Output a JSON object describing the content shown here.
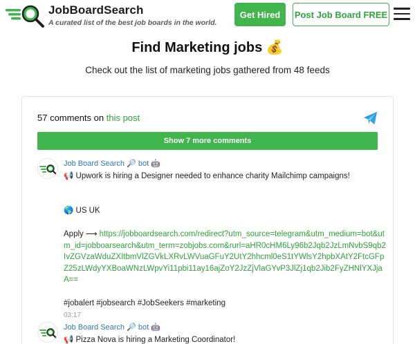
{
  "header": {
    "brand": "JobBoardSearch",
    "tagline": "A curated list of the best job boards in the world.",
    "get_hired_label": "Get Hired",
    "post_job_label": "Post Job Board FREE"
  },
  "hero": {
    "title": "Find Marketing jobs 💰",
    "subtitle": "Check out the list of marketing jobs gathered from 48 feeds"
  },
  "comments": {
    "count_text": "57 comments on",
    "post_link": "this post",
    "show_more_label": "Show 7 more comments",
    "items": [
      {
        "author": "Job Board Search 🔎 bot 🤖",
        "headline": "📢 Upwork is hiring a Designer needed to enhance charity Mailchimp campaigns!",
        "location": "🌎 US UK",
        "apply_prefix": "Apply ⟶ ",
        "apply_url": "https://jobboardsearch.com/redirect?utm_source=telegram&utm_medium=bot&utm_id=jobboarsearch&utm_term=zobjobs.com&rurl=aHR0cHM6Ly96b2Jqb2JzLmNvbS9qb2IvZGVzaWduZXItbmVlZGVkLXRvLWVuaGFuY2UtY2hhcml0eS1tYWlsY2hpbXAtY2FtcGFpZ25zLWdyYXBoaWNzLWpvYi11pbi11ay16ajZoY2JzZjVlaGYvP3JlZj1qb2Jib2FyZHNlYXJjaA==",
        "tags": "#jobalert #jobsearch #JobSeekers #marketing",
        "time": "03:17"
      },
      {
        "author": "Job Board Search 🔎 bot 🤖",
        "headline": "📢 Pizza Nova is hiring a Marketing Coordinator!"
      }
    ]
  },
  "colors": {
    "accent_green": "#3fb54b",
    "link_blue": "#2a7ab8",
    "telegram_blue": "#2aa3df"
  },
  "icons": {
    "logo": "job-search-logo-icon",
    "telegram": "telegram-icon",
    "menu": "hamburger-menu-icon"
  }
}
